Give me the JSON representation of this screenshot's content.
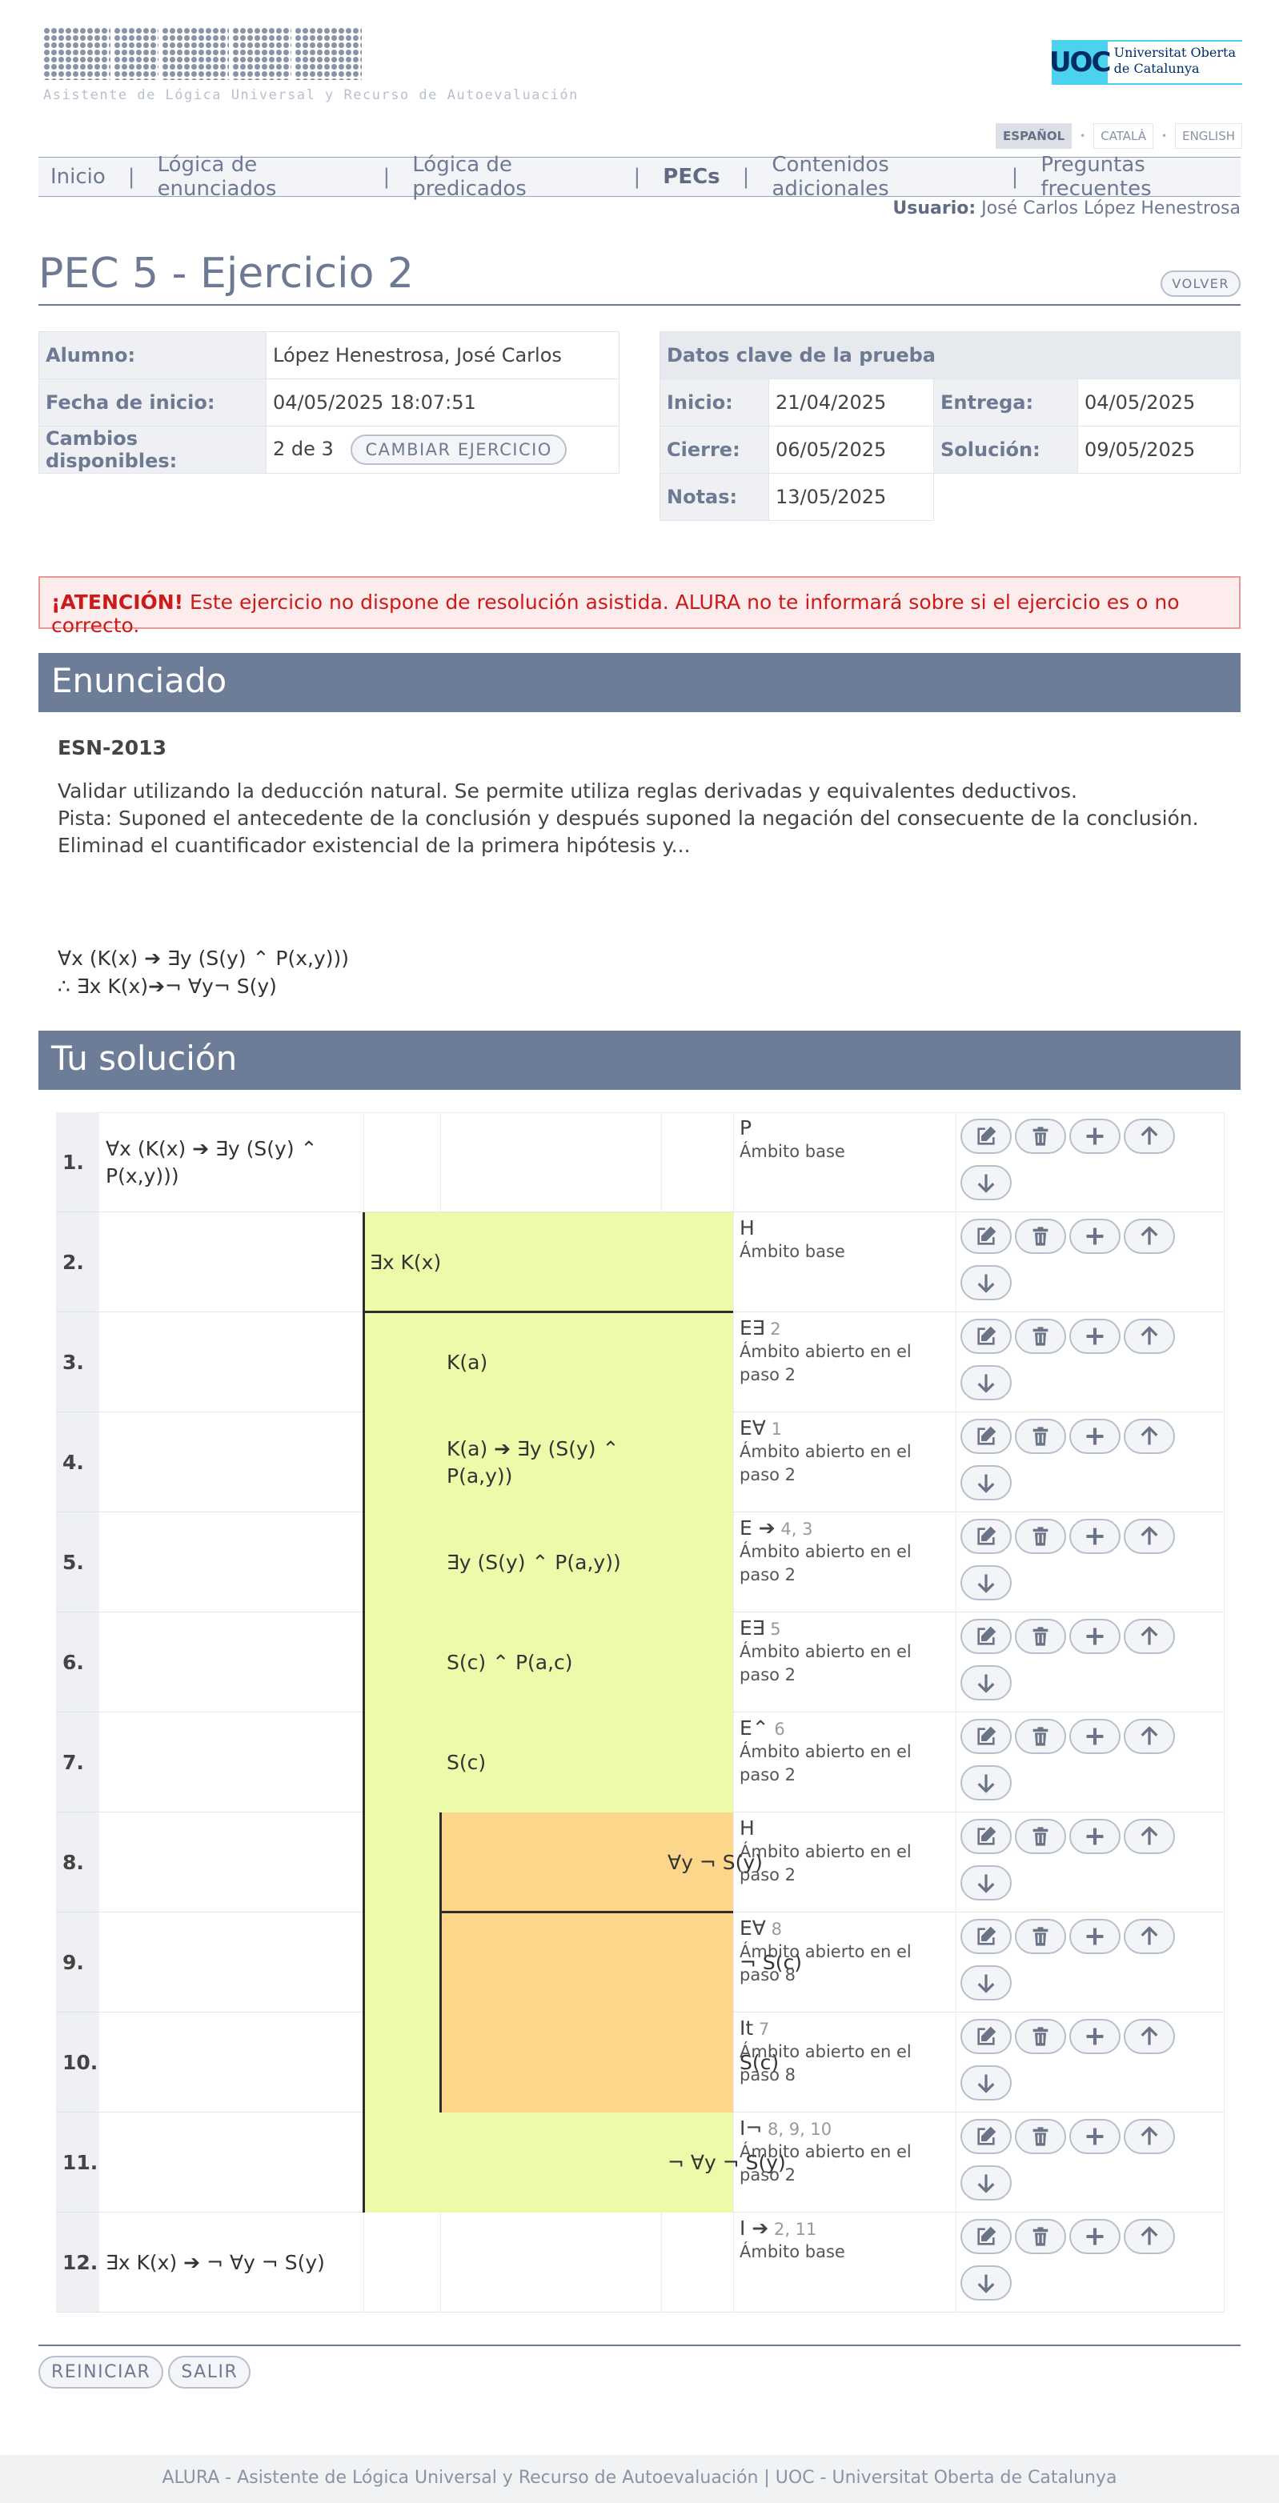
{
  "header": {
    "logo_text": "ALURA",
    "logo_subtitle": "Asistente de Lógica Universal y Recurso de Autoevaluación",
    "uoc_logo": "UOC",
    "uoc_line1": "Universitat Oberta",
    "uoc_line2": "de Catalunya",
    "languages": [
      "ESPAÑOL",
      "CATALÀ",
      "ENGLISH"
    ],
    "active_language": "ESPAÑOL"
  },
  "nav": {
    "items": [
      "Inicio",
      "Lógica de enunciados",
      "Lógica de predicados",
      "PECs",
      "Contenidos adicionales",
      "Preguntas frecuentes"
    ],
    "active": "PECs",
    "separator": "|"
  },
  "user": {
    "label": "Usuario:",
    "name": "José Carlos López Henestrosa"
  },
  "page": {
    "title": "PEC 5 - Ejercicio 2",
    "back_button": "VOLVER"
  },
  "student": {
    "alumno_label": "Alumno:",
    "alumno": "López Henestrosa, José Carlos",
    "fecha_label": "Fecha de inicio:",
    "fecha": "04/05/2025 18:07:51",
    "cambios_label": "Cambios disponibles:",
    "cambios": "2 de 3",
    "cambiar_button": "CAMBIAR EJERCICIO"
  },
  "test_dates": {
    "title": "Datos clave de la prueba",
    "inicio_label": "Inicio:",
    "inicio": "21/04/2025",
    "entrega_label": "Entrega:",
    "entrega": "04/05/2025",
    "cierre_label": "Cierre:",
    "cierre": "06/05/2025",
    "solucion_label": "Solución:",
    "solucion": "09/05/2025",
    "notas_label": "Notas:",
    "notas": "13/05/2025"
  },
  "warning": {
    "strong": "¡ATENCIÓN!",
    "text": " Este ejercicio no dispone de resolución asistida. ALURA no te informará sobre si el ejercicio es o no correcto."
  },
  "statement": {
    "heading": "Enunciado",
    "code": "ESN-2013",
    "line1": "Validar utilizando la deducción natural. Se permite utiliza reglas derivadas y equivalentes deductivos.",
    "line2": "Pista: Suponed el antecedente de la conclusión y después suponed la negación del consecuente de la conclusión. Eliminad el cuantificador existencial de la primera hipótesis y...",
    "premise": "∀x (K(x) ➔ ∃y (S(y) ⌃ P(x,y)))",
    "conclusion": "∴ ∃x K(x)➔¬ ∀y¬ S(y)"
  },
  "solution": {
    "heading": "Tu solución",
    "rows": [
      {
        "n": "1.",
        "formula": "∀x (K(x) ➔ ∃y (S(y) ⌃ P(x,y)))",
        "rule": "P",
        "refs": "",
        "scope": "Ámbito base"
      },
      {
        "n": "2.",
        "formula": "∃x K(x)",
        "rule": "H",
        "refs": "",
        "scope": "Ámbito base"
      },
      {
        "n": "3.",
        "formula": "K(a)",
        "rule": "E∃",
        "refs": " 2",
        "scope": "Ámbito abierto en el paso 2"
      },
      {
        "n": "4.",
        "formula": "K(a) ➔ ∃y (S(y) ⌃ P(a,y))",
        "rule": "E∀",
        "refs": " 1",
        "scope": "Ámbito abierto en el paso 2"
      },
      {
        "n": "5.",
        "formula": "∃y (S(y) ⌃ P(a,y))",
        "rule": "E ➔",
        "refs": " 4, 3",
        "scope": "Ámbito abierto en el paso 2"
      },
      {
        "n": "6.",
        "formula": "S(c) ⌃ P(a,c)",
        "rule": "E∃",
        "refs": " 5",
        "scope": "Ámbito abierto en el paso 2"
      },
      {
        "n": "7.",
        "formula": "S(c)",
        "rule": "E⌃",
        "refs": " 6",
        "scope": "Ámbito abierto en el paso 2"
      },
      {
        "n": "8.",
        "formula": "∀y ¬ S(y)",
        "rule": "H",
        "refs": "",
        "scope": "Ámbito abierto en el paso 2"
      },
      {
        "n": "9.",
        "formula": "¬ S(c)",
        "rule": "E∀",
        "refs": " 8",
        "scope": "Ámbito abierto en el paso 8"
      },
      {
        "n": "10.",
        "formula": "S(c)",
        "rule": "It",
        "refs": " 7",
        "scope": "Ámbito abierto en el paso 8"
      },
      {
        "n": "11.",
        "formula": "¬ ∀y ¬ S(y)",
        "rule": "I¬",
        "refs": " 8, 9, 10",
        "scope": "Ámbito abierto en el paso 2"
      },
      {
        "n": "12.",
        "formula": "∃x K(x) ➔ ¬ ∀y ¬ S(y)",
        "rule": "I ➔",
        "refs": " 2, 11",
        "scope": "Ámbito base"
      }
    ]
  },
  "bottom_buttons": {
    "reiniciar": "REINICIAR",
    "salir": "SALIR"
  },
  "footer": {
    "text": "ALURA - Asistente de Lógica Universal y Recurso de Autoevaluación | UOC - Universitat Oberta de Catalunya"
  },
  "colors": {
    "green_scope": "#ecfba9",
    "orange_scope": "#fcd78b",
    "header_bar": "#6e7d97",
    "warning_text": "#cc1a1a"
  }
}
